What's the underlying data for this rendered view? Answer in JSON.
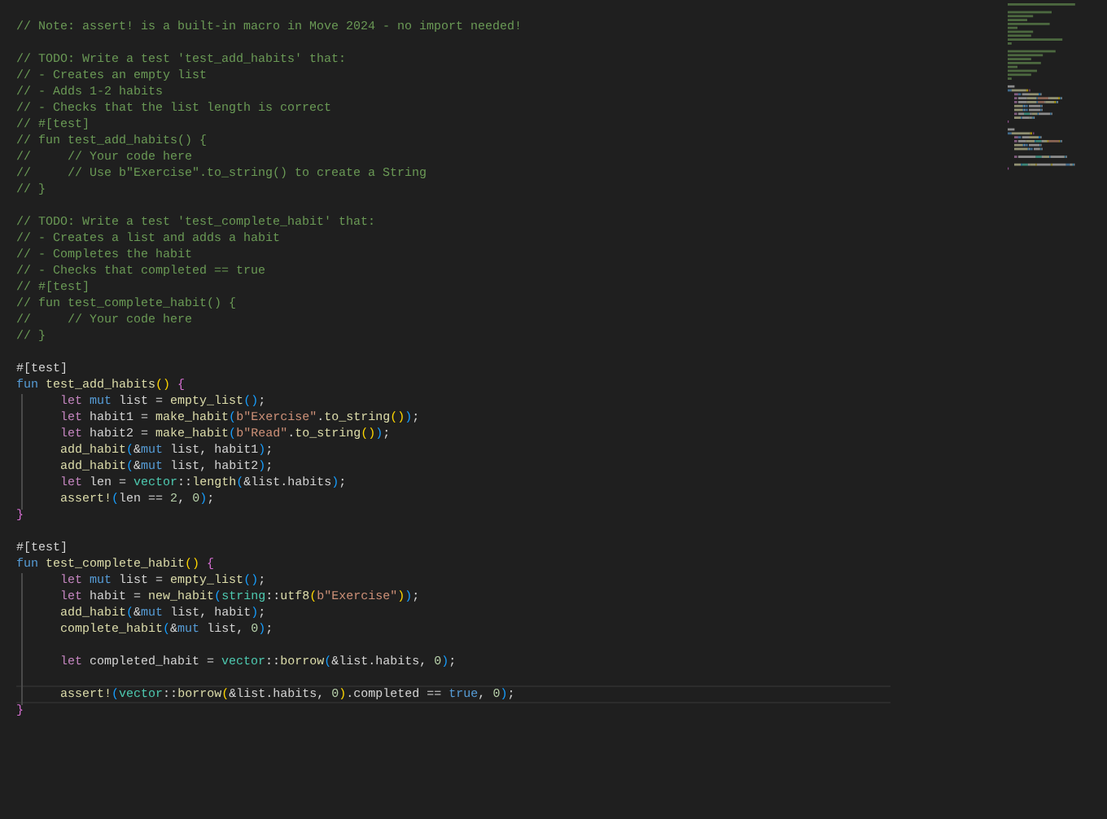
{
  "editor": {
    "lines": [
      {
        "indented": false,
        "current": false,
        "tokens": [
          {
            "kind": "comment",
            "text": "// Note: assert! is a built-in macro in Move 2024 - no import needed!"
          }
        ]
      },
      {
        "indented": false,
        "current": false
      },
      {
        "indented": false,
        "current": false,
        "tokens": [
          {
            "kind": "comment",
            "text": "// TODO: Write a test 'test_add_habits' that:"
          }
        ]
      },
      {
        "indented": false,
        "current": false,
        "tokens": [
          {
            "kind": "comment",
            "text": "// - Creates an empty list"
          }
        ]
      },
      {
        "indented": false,
        "current": false,
        "tokens": [
          {
            "kind": "comment",
            "text": "// - Adds 1-2 habits"
          }
        ]
      },
      {
        "indented": false,
        "current": false,
        "tokens": [
          {
            "kind": "comment",
            "text": "// - Checks that the list length is correct"
          }
        ]
      },
      {
        "indented": false,
        "current": false,
        "tokens": [
          {
            "kind": "comment",
            "text": "// #[test]"
          }
        ]
      },
      {
        "indented": false,
        "current": false,
        "tokens": [
          {
            "kind": "comment",
            "text": "// fun test_add_habits() {"
          }
        ]
      },
      {
        "indented": false,
        "current": false,
        "tokens": [
          {
            "kind": "comment",
            "text": "//     // Your code here"
          }
        ]
      },
      {
        "indented": false,
        "current": false,
        "tokens": [
          {
            "kind": "comment",
            "text": "//     // Use b\"Exercise\".to_string() to create a String"
          }
        ]
      },
      {
        "indented": false,
        "current": false,
        "tokens": [
          {
            "kind": "comment",
            "text": "// }"
          }
        ]
      },
      {
        "indented": false,
        "current": false
      },
      {
        "indented": false,
        "current": false,
        "tokens": [
          {
            "kind": "comment",
            "text": "// TODO: Write a test 'test_complete_habit' that:"
          }
        ]
      },
      {
        "indented": false,
        "current": false,
        "tokens": [
          {
            "kind": "comment",
            "text": "// - Creates a list and adds a habit"
          }
        ]
      },
      {
        "indented": false,
        "current": false,
        "tokens": [
          {
            "kind": "comment",
            "text": "// - Completes the habit"
          }
        ]
      },
      {
        "indented": false,
        "current": false,
        "tokens": [
          {
            "kind": "comment",
            "text": "// - Checks that completed == true"
          }
        ]
      },
      {
        "indented": false,
        "current": false,
        "tokens": [
          {
            "kind": "comment",
            "text": "// #[test]"
          }
        ]
      },
      {
        "indented": false,
        "current": false,
        "tokens": [
          {
            "kind": "comment",
            "text": "// fun test_complete_habit() {"
          }
        ]
      },
      {
        "indented": false,
        "current": false,
        "tokens": [
          {
            "kind": "comment",
            "text": "//     // Your code here"
          }
        ]
      },
      {
        "indented": false,
        "current": false,
        "tokens": [
          {
            "kind": "comment",
            "text": "// }"
          }
        ]
      },
      {
        "indented": false,
        "current": false
      },
      {
        "indented": false,
        "current": false,
        "tokens": [
          {
            "kind": "attribute",
            "text": "#[test]"
          }
        ]
      },
      {
        "indented": false,
        "current": false,
        "tokens": [
          {
            "kind": "keyword",
            "text": "fun "
          },
          {
            "kind": "function",
            "text": "test_add_habits"
          },
          {
            "kind": "bracket1",
            "text": "()"
          },
          {
            "kind": "bracket2",
            "text": " {"
          }
        ]
      },
      {
        "indented": true,
        "current": false,
        "tokens": [
          {
            "kind": "control",
            "text": "let "
          },
          {
            "kind": "keyword",
            "text": "mut"
          },
          {
            "kind": "plain",
            "text": " list = "
          },
          {
            "kind": "function",
            "text": "empty_list"
          },
          {
            "kind": "bracket3",
            "text": "()"
          },
          {
            "kind": "plain",
            "text": ";"
          }
        ]
      },
      {
        "indented": true,
        "current": false,
        "tokens": [
          {
            "kind": "control",
            "text": "let"
          },
          {
            "kind": "plain",
            "text": " habit1 = "
          },
          {
            "kind": "function",
            "text": "make_habit"
          },
          {
            "kind": "bracket3",
            "text": "("
          },
          {
            "kind": "string",
            "text": "b\"Exercise\""
          },
          {
            "kind": "plain",
            "text": "."
          },
          {
            "kind": "function",
            "text": "to_string"
          },
          {
            "kind": "bracket1",
            "text": "()"
          },
          {
            "kind": "bracket3",
            "text": ")"
          },
          {
            "kind": "plain",
            "text": ";"
          }
        ]
      },
      {
        "indented": true,
        "current": false,
        "tokens": [
          {
            "kind": "control",
            "text": "let"
          },
          {
            "kind": "plain",
            "text": " habit2 = "
          },
          {
            "kind": "function",
            "text": "make_habit"
          },
          {
            "kind": "bracket3",
            "text": "("
          },
          {
            "kind": "string",
            "text": "b\"Read\""
          },
          {
            "kind": "plain",
            "text": "."
          },
          {
            "kind": "function",
            "text": "to_string"
          },
          {
            "kind": "bracket1",
            "text": "()"
          },
          {
            "kind": "bracket3",
            "text": ")"
          },
          {
            "kind": "plain",
            "text": ";"
          }
        ]
      },
      {
        "indented": true,
        "current": false,
        "tokens": [
          {
            "kind": "function",
            "text": "add_habit"
          },
          {
            "kind": "bracket3",
            "text": "("
          },
          {
            "kind": "plain",
            "text": "&"
          },
          {
            "kind": "keyword",
            "text": "mut"
          },
          {
            "kind": "plain",
            "text": " list, habit1"
          },
          {
            "kind": "bracket3",
            "text": ")"
          },
          {
            "kind": "plain",
            "text": ";"
          }
        ]
      },
      {
        "indented": true,
        "current": false,
        "tokens": [
          {
            "kind": "function",
            "text": "add_habit"
          },
          {
            "kind": "bracket3",
            "text": "("
          },
          {
            "kind": "plain",
            "text": "&"
          },
          {
            "kind": "keyword",
            "text": "mut"
          },
          {
            "kind": "plain",
            "text": " list, habit2"
          },
          {
            "kind": "bracket3",
            "text": ")"
          },
          {
            "kind": "plain",
            "text": ";"
          }
        ]
      },
      {
        "indented": true,
        "current": false,
        "tokens": [
          {
            "kind": "control",
            "text": "let"
          },
          {
            "kind": "plain",
            "text": " len = "
          },
          {
            "kind": "module",
            "text": "vector"
          },
          {
            "kind": "plain",
            "text": "::"
          },
          {
            "kind": "function",
            "text": "length"
          },
          {
            "kind": "bracket3",
            "text": "("
          },
          {
            "kind": "plain",
            "text": "&list.habits"
          },
          {
            "kind": "bracket3",
            "text": ")"
          },
          {
            "kind": "plain",
            "text": ";"
          }
        ]
      },
      {
        "indented": true,
        "current": false,
        "tokens": [
          {
            "kind": "function",
            "text": "assert!"
          },
          {
            "kind": "bracket3",
            "text": "("
          },
          {
            "kind": "plain",
            "text": "len == "
          },
          {
            "kind": "number",
            "text": "2"
          },
          {
            "kind": "plain",
            "text": ", "
          },
          {
            "kind": "number",
            "text": "0"
          },
          {
            "kind": "bracket3",
            "text": ")"
          },
          {
            "kind": "plain",
            "text": ";"
          }
        ]
      },
      {
        "indented": false,
        "current": false,
        "tokens": [
          {
            "kind": "bracket2",
            "text": "}"
          }
        ]
      },
      {
        "indented": false,
        "current": false
      },
      {
        "indented": false,
        "current": false,
        "tokens": [
          {
            "kind": "attribute",
            "text": "#[test]"
          }
        ]
      },
      {
        "indented": false,
        "current": false,
        "tokens": [
          {
            "kind": "keyword",
            "text": "fun "
          },
          {
            "kind": "function",
            "text": "test_complete_habit"
          },
          {
            "kind": "bracket1",
            "text": "()"
          },
          {
            "kind": "bracket2",
            "text": " {"
          }
        ]
      },
      {
        "indented": true,
        "current": false,
        "tokens": [
          {
            "kind": "control",
            "text": "let "
          },
          {
            "kind": "keyword",
            "text": "mut"
          },
          {
            "kind": "plain",
            "text": " list = "
          },
          {
            "kind": "function",
            "text": "empty_list"
          },
          {
            "kind": "bracket3",
            "text": "()"
          },
          {
            "kind": "plain",
            "text": ";"
          }
        ]
      },
      {
        "indented": true,
        "current": false,
        "tokens": [
          {
            "kind": "control",
            "text": "let"
          },
          {
            "kind": "plain",
            "text": " habit = "
          },
          {
            "kind": "function",
            "text": "new_habit"
          },
          {
            "kind": "bracket3",
            "text": "("
          },
          {
            "kind": "module",
            "text": "string"
          },
          {
            "kind": "plain",
            "text": "::"
          },
          {
            "kind": "function",
            "text": "utf8"
          },
          {
            "kind": "bracket1",
            "text": "("
          },
          {
            "kind": "string",
            "text": "b\"Exercise\""
          },
          {
            "kind": "bracket1",
            "text": ")"
          },
          {
            "kind": "bracket3",
            "text": ")"
          },
          {
            "kind": "plain",
            "text": ";"
          }
        ]
      },
      {
        "indented": true,
        "current": false,
        "tokens": [
          {
            "kind": "function",
            "text": "add_habit"
          },
          {
            "kind": "bracket3",
            "text": "("
          },
          {
            "kind": "plain",
            "text": "&"
          },
          {
            "kind": "keyword",
            "text": "mut"
          },
          {
            "kind": "plain",
            "text": " list, habit"
          },
          {
            "kind": "bracket3",
            "text": ")"
          },
          {
            "kind": "plain",
            "text": ";"
          }
        ]
      },
      {
        "indented": true,
        "current": false,
        "tokens": [
          {
            "kind": "function",
            "text": "complete_habit"
          },
          {
            "kind": "bracket3",
            "text": "("
          },
          {
            "kind": "plain",
            "text": "&"
          },
          {
            "kind": "keyword",
            "text": "mut"
          },
          {
            "kind": "plain",
            "text": " list, "
          },
          {
            "kind": "number",
            "text": "0"
          },
          {
            "kind": "bracket3",
            "text": ")"
          },
          {
            "kind": "plain",
            "text": ";"
          }
        ]
      },
      {
        "indented": true,
        "current": false
      },
      {
        "indented": true,
        "current": false,
        "tokens": [
          {
            "kind": "control",
            "text": "let"
          },
          {
            "kind": "plain",
            "text": " completed_habit = "
          },
          {
            "kind": "module",
            "text": "vector"
          },
          {
            "kind": "plain",
            "text": "::"
          },
          {
            "kind": "function",
            "text": "borrow"
          },
          {
            "kind": "bracket3",
            "text": "("
          },
          {
            "kind": "plain",
            "text": "&list.habits, "
          },
          {
            "kind": "number",
            "text": "0"
          },
          {
            "kind": "bracket3",
            "text": ")"
          },
          {
            "kind": "plain",
            "text": ";"
          }
        ]
      },
      {
        "indented": true,
        "current": false
      },
      {
        "indented": true,
        "current": true,
        "tokens": [
          {
            "kind": "function",
            "text": "assert!"
          },
          {
            "kind": "bracket3",
            "text": "("
          },
          {
            "kind": "module",
            "text": "vector"
          },
          {
            "kind": "plain",
            "text": "::"
          },
          {
            "kind": "function",
            "text": "borrow"
          },
          {
            "kind": "bracket1",
            "text": "("
          },
          {
            "kind": "plain",
            "text": "&list.habits, "
          },
          {
            "kind": "number",
            "text": "0"
          },
          {
            "kind": "bracket1",
            "text": ")"
          },
          {
            "kind": "plain",
            "text": ".completed == "
          },
          {
            "kind": "constant",
            "text": "true"
          },
          {
            "kind": "plain",
            "text": ", "
          },
          {
            "kind": "number",
            "text": "0"
          },
          {
            "kind": "bracket3",
            "text": ")"
          },
          {
            "kind": "plain",
            "text": ";"
          }
        ]
      },
      {
        "indented": false,
        "current": false,
        "tokens": [
          {
            "kind": "bracket2",
            "text": "}"
          }
        ]
      }
    ]
  }
}
